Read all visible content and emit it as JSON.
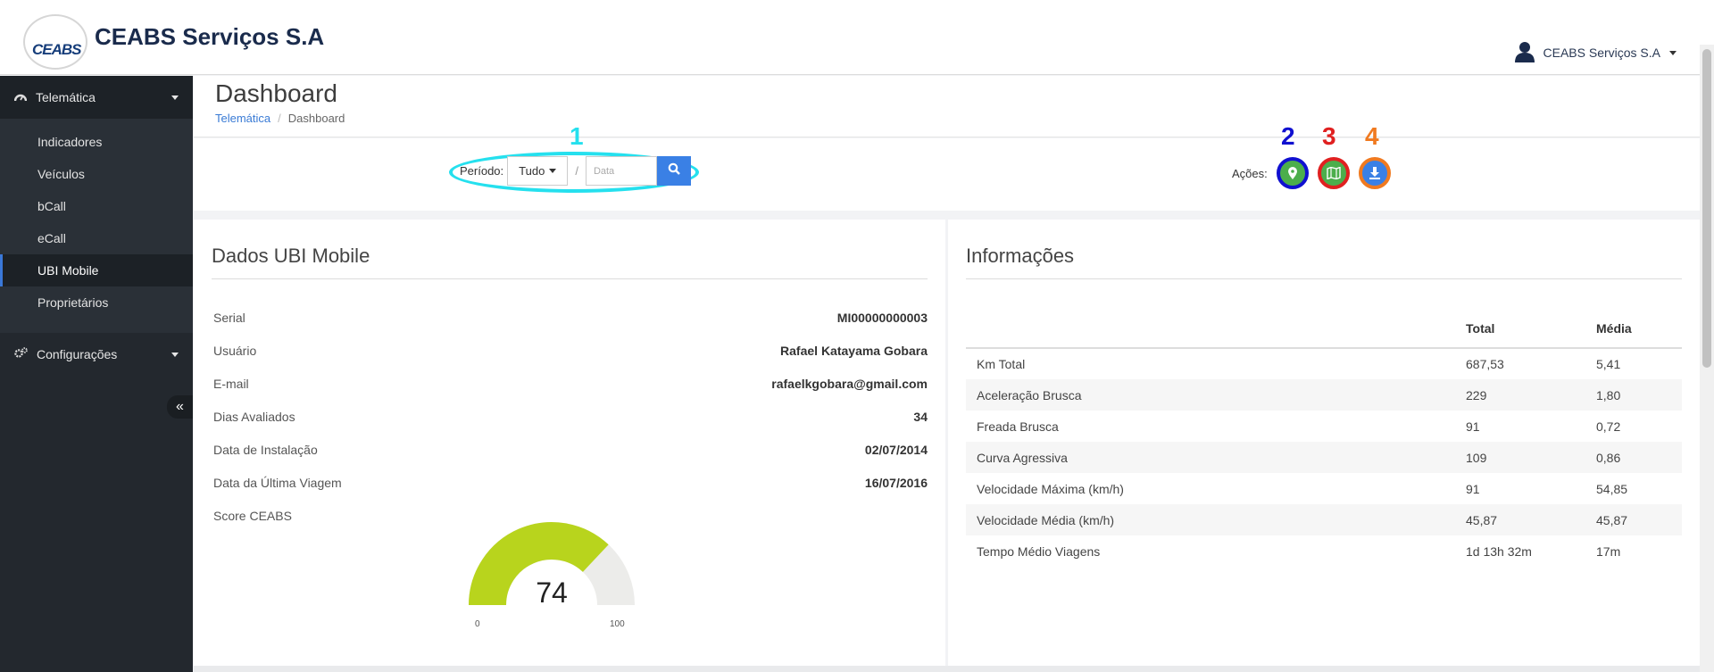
{
  "header": {
    "logo_text": "CEABS",
    "logo_subtext": "",
    "brand": "CEABS Serviços S.A",
    "user_label": "CEABS Serviços S.A",
    "user_icon": "user-icon"
  },
  "sidebar": {
    "sections": [
      {
        "label": "Telemática",
        "icon": "dashboard-icon"
      },
      {
        "label": "Configurações",
        "icon": "gears-icon"
      }
    ],
    "items": [
      {
        "label": "Indicadores"
      },
      {
        "label": "Veículos"
      },
      {
        "label": "bCall"
      },
      {
        "label": "eCall"
      },
      {
        "label": "UBI Mobile",
        "active": true
      },
      {
        "label": "Proprietários"
      }
    ],
    "collapse_icon": "double-chevron-left-icon"
  },
  "page": {
    "title": "Dashboard",
    "breadcrumb": [
      "Telemática",
      "Dashboard"
    ]
  },
  "toolbar": {
    "periodo_label": "Período:",
    "periodo_value": "Tudo",
    "separator": "/",
    "date_placeholder": "Data",
    "acoes_label": "Ações:",
    "annotations": [
      "1",
      "2",
      "3",
      "4"
    ],
    "annotation_colors": {
      "1": "#25e0ee",
      "2": "#1010d0",
      "3": "#e02020",
      "4": "#f07a20"
    },
    "action_buttons": [
      {
        "icon": "map-marker-icon",
        "color": "#4cae4c"
      },
      {
        "icon": "map-icon",
        "color": "#4cae4c"
      },
      {
        "icon": "download-icon",
        "color": "#3a80e5"
      }
    ]
  },
  "dados": {
    "title": "Dados UBI Mobile",
    "rows": [
      {
        "label": "Serial",
        "value": "MI00000000003"
      },
      {
        "label": "Usuário",
        "value": "Rafael Katayama Gobara"
      },
      {
        "label": "E-mail",
        "value": "rafaelkgobara@gmail.com"
      },
      {
        "label": "Dias Avaliados",
        "value": "34"
      },
      {
        "label": "Data de Instalação",
        "value": "02/07/2014"
      },
      {
        "label": "Data da Última Viagem",
        "value": "16/07/2016"
      },
      {
        "label": "Score CEABS",
        "value": ""
      }
    ],
    "gauge": {
      "value": "74",
      "min": "0",
      "max": "100",
      "score": 74,
      "color": "#b8d41d",
      "track_color": "#ececea"
    }
  },
  "informacoes": {
    "title": "Informações",
    "columns": [
      "",
      "Total",
      "Média"
    ],
    "rows": [
      [
        "Km Total",
        "687,53",
        "5,41"
      ],
      [
        "Aceleração Brusca",
        "229",
        "1,80"
      ],
      [
        "Freada Brusca",
        "91",
        "0,72"
      ],
      [
        "Curva Agressiva",
        "109",
        "0,86"
      ],
      [
        "Velocidade Máxima (km/h)",
        "91",
        "54,85"
      ],
      [
        "Velocidade Média (km/h)",
        "45,87",
        "45,87"
      ],
      [
        "Tempo Médio Viagens",
        "1d 13h 32m",
        "17m"
      ]
    ]
  }
}
